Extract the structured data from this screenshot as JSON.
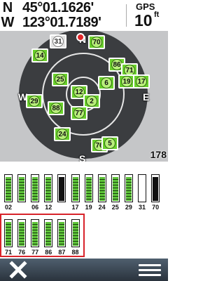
{
  "header": {
    "lat_hemisphere": "N",
    "lat_value": "45°01.1626'",
    "lon_hemisphere": "W",
    "lon_value": "123°01.7189'",
    "gps_label": "GPS",
    "accuracy_value": "10",
    "accuracy_unit": "ft"
  },
  "skyview": {
    "compass": {
      "north": "N",
      "south": "S",
      "east": "E",
      "west": "W"
    },
    "elevation_readout": "178",
    "satellites": [
      {
        "id": "31",
        "strength": "weak"
      },
      {
        "id": "70",
        "strength": "strong"
      },
      {
        "id": "14",
        "strength": "strong"
      },
      {
        "id": "86",
        "strength": "strong"
      },
      {
        "id": "71",
        "strength": "strong"
      },
      {
        "id": "25",
        "strength": "strong"
      },
      {
        "id": "6",
        "strength": "strong"
      },
      {
        "id": "19",
        "strength": "strong"
      },
      {
        "id": "17",
        "strength": "strong"
      },
      {
        "id": "12",
        "strength": "strong"
      },
      {
        "id": "29",
        "strength": "strong"
      },
      {
        "id": "2",
        "strength": "strong"
      },
      {
        "id": "88",
        "strength": "strong"
      },
      {
        "id": "77",
        "strength": "strong"
      },
      {
        "id": "24",
        "strength": "strong"
      },
      {
        "id": "76",
        "strength": "strong"
      },
      {
        "id": "5",
        "strength": "strong"
      }
    ]
  },
  "signal_bars": {
    "row1": [
      {
        "label": "02",
        "level": 0.95,
        "type": "green"
      },
      {
        "label": "",
        "level": 0.95,
        "type": "green"
      },
      {
        "label": "06",
        "level": 0.95,
        "type": "green"
      },
      {
        "label": "12",
        "level": 0.95,
        "type": "green"
      },
      {
        "label": "",
        "level": 0.95,
        "type": "gray"
      },
      {
        "label": "17",
        "level": 0.95,
        "type": "green"
      },
      {
        "label": "19",
        "level": 0.95,
        "type": "green"
      },
      {
        "label": "24",
        "level": 0.95,
        "type": "green"
      },
      {
        "label": "25",
        "level": 0.95,
        "type": "green"
      },
      {
        "label": "29",
        "level": 0.95,
        "type": "green"
      },
      {
        "label": "31",
        "level": 0.0,
        "type": "gray"
      },
      {
        "label": "70",
        "level": 0.95,
        "type": "gray"
      }
    ],
    "row2": [
      {
        "label": "71",
        "level": 0.95,
        "type": "green"
      },
      {
        "label": "76",
        "level": 0.95,
        "type": "green"
      },
      {
        "label": "77",
        "level": 0.95,
        "type": "green"
      },
      {
        "label": "86",
        "level": 0.95,
        "type": "green"
      },
      {
        "label": "87",
        "level": 0.95,
        "type": "green"
      },
      {
        "label": "88",
        "level": 0.95,
        "type": "green"
      }
    ]
  },
  "footer": {
    "back_icon": "close-x-icon",
    "menu_icon": "menu-icon"
  },
  "colors": {
    "sat_green": "#6bd02c",
    "selection_red": "#d8232a",
    "footer_dark": "#2a333d"
  }
}
